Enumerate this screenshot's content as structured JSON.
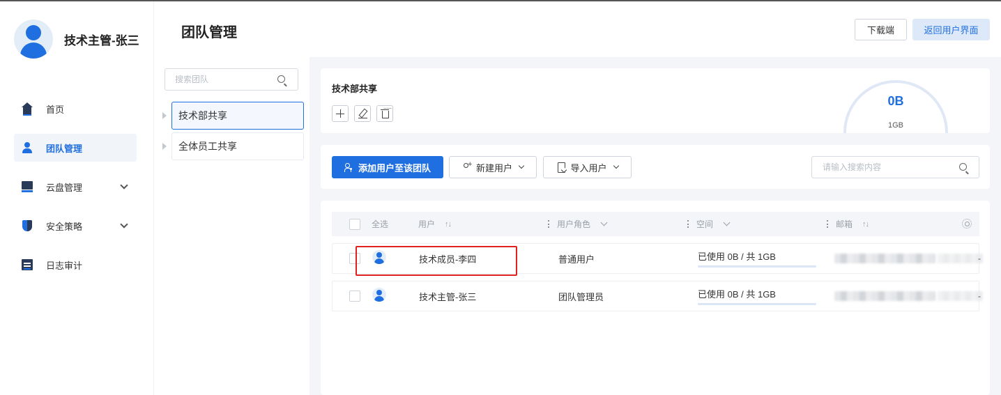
{
  "profile": {
    "name": "技术主管-张三"
  },
  "nav": [
    {
      "label": "首页",
      "icon": "home-icon",
      "active": false,
      "expandable": false
    },
    {
      "label": "团队管理",
      "icon": "team-icon",
      "active": true,
      "expandable": false
    },
    {
      "label": "云盘管理",
      "icon": "cloud-disk-icon",
      "active": false,
      "expandable": true
    },
    {
      "label": "安全策略",
      "icon": "shield-icon",
      "active": false,
      "expandable": true
    },
    {
      "label": "日志审计",
      "icon": "log-icon",
      "active": false,
      "expandable": false
    }
  ],
  "header": {
    "title": "团队管理",
    "download_label": "下载端",
    "return_label": "返回用户界面"
  },
  "team_list": {
    "search_placeholder": "搜索团队",
    "items": [
      {
        "name": "技术部共享",
        "selected": true
      },
      {
        "name": "全体员工共享",
        "selected": false
      }
    ]
  },
  "team_detail": {
    "name": "技术部共享",
    "quota_used": "0B",
    "quota_total": "1GB"
  },
  "actions": {
    "add_to_team_label": "添加用户至该团队",
    "new_user_label": "新建用户",
    "import_user_label": "导入用户",
    "search_placeholder": "请输入搜索内容"
  },
  "table": {
    "columns": {
      "select_all": "全选",
      "user": "用户",
      "role": "用户角色",
      "space": "空间",
      "email": "邮箱"
    },
    "rows": [
      {
        "user": "技术成员-李四",
        "role": "普通用户",
        "space": "已使用 0B / 共 1GB",
        "space_fraction": 0.0,
        "tail": "-"
      },
      {
        "user": "技术主管-张三",
        "role": "团队管理员",
        "space": "已使用 0B / 共 1GB",
        "space_fraction": 0.0,
        "tail": "-"
      }
    ]
  },
  "colors": {
    "accent": "#1f6fe0",
    "accent_light": "#dde8f8",
    "highlight": "#e02020",
    "content_bg": "#f4f5f8"
  }
}
